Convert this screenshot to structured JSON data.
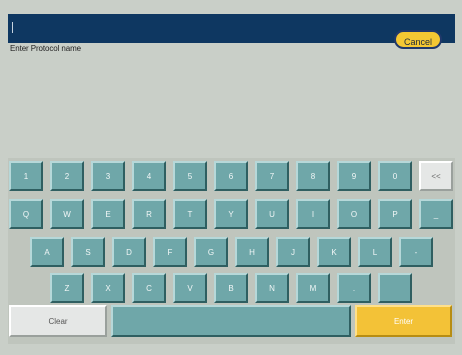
{
  "header": {
    "input_value": "|",
    "prompt": "Enter Protocol name",
    "cancel_label": "Cancel"
  },
  "keyboard": {
    "row1": [
      "1",
      "2",
      "3",
      "4",
      "5",
      "6",
      "7",
      "8",
      "9",
      "0",
      "<<"
    ],
    "row2": [
      "Q",
      "W",
      "E",
      "R",
      "T",
      "Y",
      "U",
      "I",
      "O",
      "P",
      "_"
    ],
    "row3": [
      "A",
      "S",
      "D",
      "F",
      "G",
      "H",
      "J",
      "K",
      "L",
      "-"
    ],
    "row4": [
      "Z",
      "X",
      "C",
      "V",
      "B",
      "N",
      "M",
      ".",
      ""
    ],
    "clear_label": "Clear",
    "space_label": "",
    "enter_label": "Enter"
  }
}
